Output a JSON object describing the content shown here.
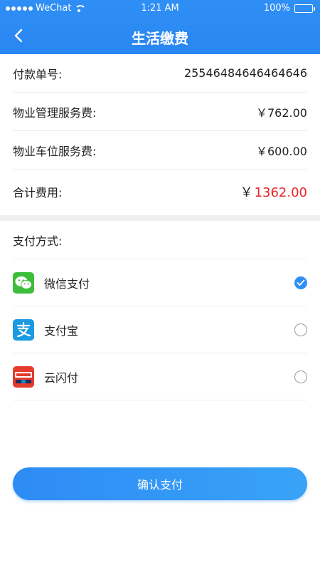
{
  "status_bar": {
    "carrier": "WeChat",
    "time": "1:21 AM",
    "battery": "100%"
  },
  "nav": {
    "title": "生活缴费"
  },
  "details": {
    "order_label": "付款单号:",
    "order_value": "25546484646464646",
    "property_mgmt_label": "物业管理服务费:",
    "property_mgmt_value": "￥762.00",
    "parking_label": "物业车位服务费:",
    "parking_value": "￥600.00",
    "total_label": "合计费用:",
    "total_currency": "￥",
    "total_value": "1362.00"
  },
  "payment": {
    "title": "支付方式:",
    "options": [
      {
        "label": "微信支付",
        "icon": "wechat-icon",
        "selected": true
      },
      {
        "label": "支付宝",
        "icon": "alipay-icon",
        "selected": false
      },
      {
        "label": "云闪付",
        "icon": "unionpay-icon",
        "selected": false
      }
    ]
  },
  "confirm_label": "确认支付",
  "colors": {
    "accent": "#2f8ff5",
    "total": "#e8242a",
    "wechat": "#3dbe3a",
    "alipay": "#1a9ae0",
    "unionpay": "#e53a2e"
  }
}
